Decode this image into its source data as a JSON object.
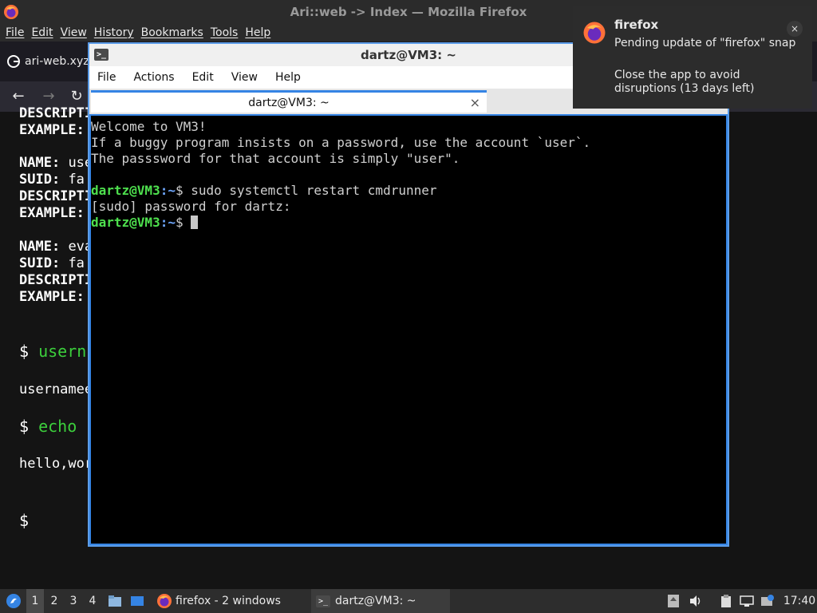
{
  "firefox": {
    "window_title": "Ari::web -> Index — Mozilla Firefox",
    "menu": [
      "File",
      "Edit",
      "View",
      "History",
      "Bookmarks",
      "Tools",
      "Help"
    ],
    "tab_title": "ari-web.xyz",
    "page_lines": [
      {
        "label": "DESCRIPTI",
        "value": ""
      },
      {
        "label": "EXAMPLE:",
        "value": ""
      },
      {
        "label": "NAME:",
        "value": "use"
      },
      {
        "label": "SUID:",
        "value": "fa"
      },
      {
        "label": "DESCRIPTI",
        "value": ""
      },
      {
        "label": "EXAMPLE:",
        "value": ""
      },
      {
        "label": "NAME:",
        "value": "eva"
      },
      {
        "label": "SUID:",
        "value": "fa"
      },
      {
        "label": "DESCRIPTI",
        "value": ""
      },
      {
        "label": "EXAMPLE:",
        "value": ""
      }
    ],
    "cmd1_prompt": "$",
    "cmd1": "usern",
    "out1": "usernamee",
    "cmd2_prompt": "$",
    "cmd2": "echo",
    "out2": "hello,wor",
    "cmd3_prompt": "$"
  },
  "terminal": {
    "window_title": "dartz@VM3: ~",
    "menu": [
      "File",
      "Actions",
      "Edit",
      "View",
      "Help"
    ],
    "tab_title": "dartz@VM3: ~",
    "tab_close": "×",
    "motd": [
      "Welcome to VM3!",
      "If a buggy program insists on a password, use the account `user`.",
      "The passsword for that account is simply \"user\"."
    ],
    "prompt_user": "dartz@VM3",
    "prompt_path": ":~",
    "prompt_sym": "$",
    "command": " sudo systemctl restart cmdrunner",
    "sudo_line": "[sudo] password for dartz:"
  },
  "notification": {
    "app": "firefox",
    "line1": "Pending update of \"firefox\" snap",
    "line2": "Close the app to avoid disruptions (13 days left)",
    "close": "×"
  },
  "taskbar": {
    "workspaces": [
      "1",
      "2",
      "3",
      "4"
    ],
    "windows": [
      {
        "label": "firefox - 2 windows",
        "icon": "firefox-icon"
      },
      {
        "label": "dartz@VM3: ~",
        "icon": "terminal-icon"
      }
    ],
    "clock": "17:40"
  },
  "colors": {
    "terminal_accent": "#3584e4",
    "prompt_green": "#4ee04e",
    "prompt_blue": "#6fa8ff"
  }
}
